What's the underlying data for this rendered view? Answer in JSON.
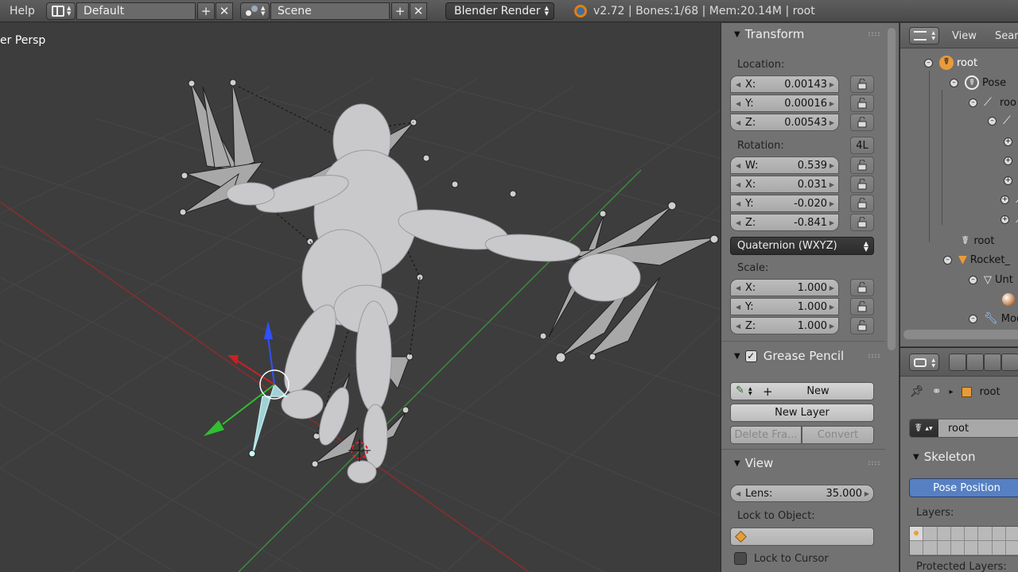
{
  "header": {
    "menu_help": "Help",
    "screen_layout": "Default",
    "scene": "Scene",
    "render_engine": "Blender Render",
    "info": "v2.72 | Bones:1/68 | Mem:20.14M | root"
  },
  "viewport": {
    "label": "er Persp"
  },
  "transform_panel": {
    "title": "Transform",
    "location_label": "Location:",
    "location": [
      {
        "axis": "X:",
        "value": "0.00143"
      },
      {
        "axis": "Y:",
        "value": "0.00016"
      },
      {
        "axis": "Z:",
        "value": "0.00543"
      }
    ],
    "rotation_label": "Rotation:",
    "rotation_lock_4l": "4L",
    "rotation": [
      {
        "axis": "W:",
        "value": "0.539"
      },
      {
        "axis": "X:",
        "value": "0.031"
      },
      {
        "axis": "Y:",
        "value": "-0.020"
      },
      {
        "axis": "Z:",
        "value": "-0.841"
      }
    ],
    "rotation_mode": "Quaternion (WXYZ)",
    "scale_label": "Scale:",
    "scale": [
      {
        "axis": "X:",
        "value": "1.000"
      },
      {
        "axis": "Y:",
        "value": "1.000"
      },
      {
        "axis": "Z:",
        "value": "1.000"
      }
    ]
  },
  "grease_pencil_panel": {
    "title": "Grease Pencil",
    "new_label": "New",
    "new_layer_label": "New Layer",
    "delete_frame_label": "Delete Fra...",
    "convert_label": "Convert"
  },
  "view_panel": {
    "title": "View",
    "lens_label": "Lens:",
    "lens_value": "35.000",
    "lock_to_object_label": "Lock to Object:",
    "lock_to_cursor_label": "Lock to Cursor"
  },
  "outliner": {
    "view_label": "View",
    "search_label": "Sear",
    "items": [
      {
        "label": "root"
      },
      {
        "label": "Pose"
      },
      {
        "label": "roo"
      },
      {
        "label": "root"
      },
      {
        "label": "Rocket_"
      },
      {
        "label": "Unt"
      },
      {
        "label": "Mod"
      }
    ]
  },
  "properties": {
    "breadcrumb": "root",
    "bone_name": "root",
    "skeleton_title": "Skeleton",
    "pose_position_label": "Pose Position",
    "layers_label": "Layers:",
    "protected_layers_label": "Protected Layers:"
  },
  "colors": {
    "accent_blue": "#5680c2",
    "viewport_bg": "#3d3d3d",
    "panel_bg": "#727272"
  }
}
